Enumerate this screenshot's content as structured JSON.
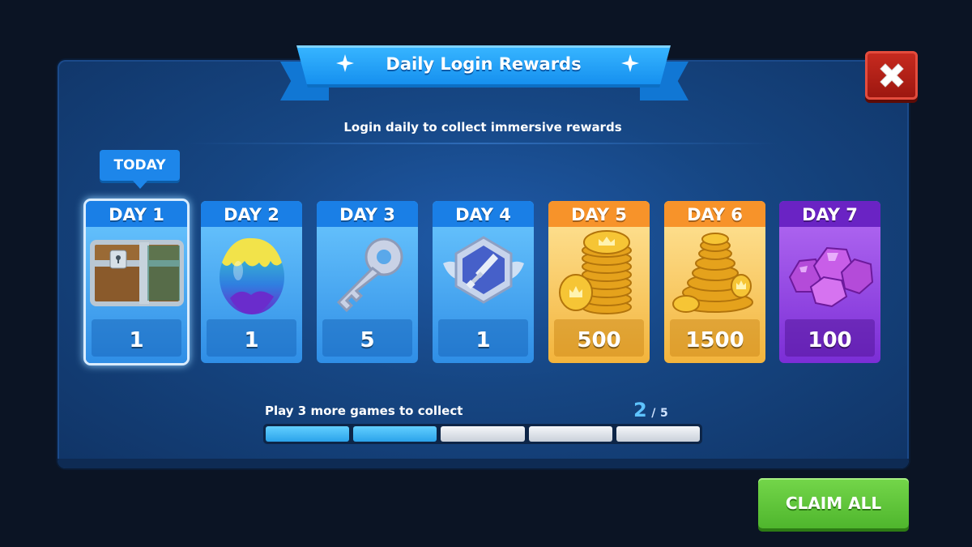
{
  "header": {
    "title": "Daily Login Rewards",
    "subtitle": "Login daily to collect immersive rewards"
  },
  "today_label": "TODAY",
  "days": [
    {
      "label": "DAY 1",
      "amount": "1",
      "reward": "treasure-chest",
      "theme": "blue",
      "selected": true
    },
    {
      "label": "DAY 2",
      "amount": "1",
      "reward": "egg",
      "theme": "blue"
    },
    {
      "label": "DAY 3",
      "amount": "5",
      "reward": "key",
      "theme": "blue"
    },
    {
      "label": "DAY 4",
      "amount": "1",
      "reward": "sword-badge",
      "theme": "blue"
    },
    {
      "label": "DAY 5",
      "amount": "500",
      "reward": "gold-coins",
      "theme": "gold"
    },
    {
      "label": "DAY 6",
      "amount": "1500",
      "reward": "gold-coin-pile",
      "theme": "gold"
    },
    {
      "label": "DAY 7",
      "amount": "100",
      "reward": "purple-gems",
      "theme": "purple"
    }
  ],
  "progress": {
    "label": "Play 3 more games to collect",
    "current": "2",
    "separator": "/",
    "total": "5",
    "completed_segments": 2,
    "segments": 5
  },
  "claim_button": "CLAIM ALL",
  "colors": {
    "accent_blue": "#1a7fe6",
    "gold": "#f7932a",
    "purple": "#6a23c4",
    "claim_green": "#5cc436",
    "close_red": "#b8231a"
  }
}
